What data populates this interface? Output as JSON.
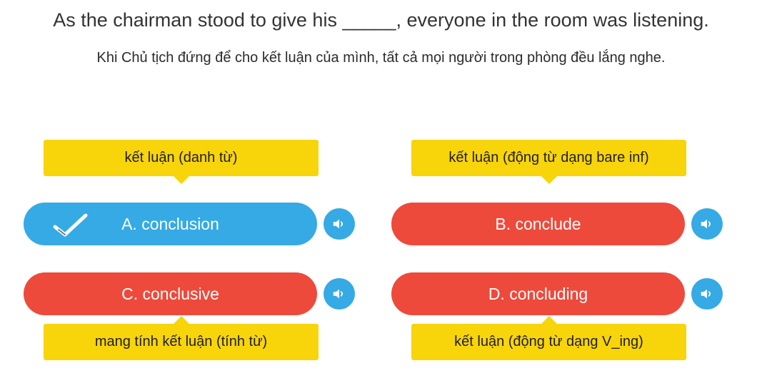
{
  "question": {
    "sentence": "As the chairman stood to give his _____, everyone in the room was listening.",
    "translation": "Khi Chủ tịch đứng để cho kết luận của mình, tất cả mọi người trong phòng đều lắng nghe."
  },
  "options": [
    {
      "label": "A. conclusion",
      "hint": "kết luận (danh từ)",
      "color": "#35aae5",
      "state": "correct",
      "icon": "checkmark-icon"
    },
    {
      "label": "B. conclude",
      "hint": "kết luận (động từ dạng bare inf)",
      "color": "#ed4a3c",
      "state": "wrong"
    },
    {
      "label": "C. conclusive",
      "hint": "mang tính kết luận (tính từ)",
      "color": "#ed4a3c",
      "state": "wrong"
    },
    {
      "label": "D. concluding",
      "hint": "kết luận (động từ dạng V_ing)",
      "color": "#ed4a3c",
      "state": "wrong"
    }
  ],
  "audio_icon": "speaker-icon",
  "colors": {
    "hint_background": "#f8d40a",
    "audio_button": "#35aae5"
  }
}
